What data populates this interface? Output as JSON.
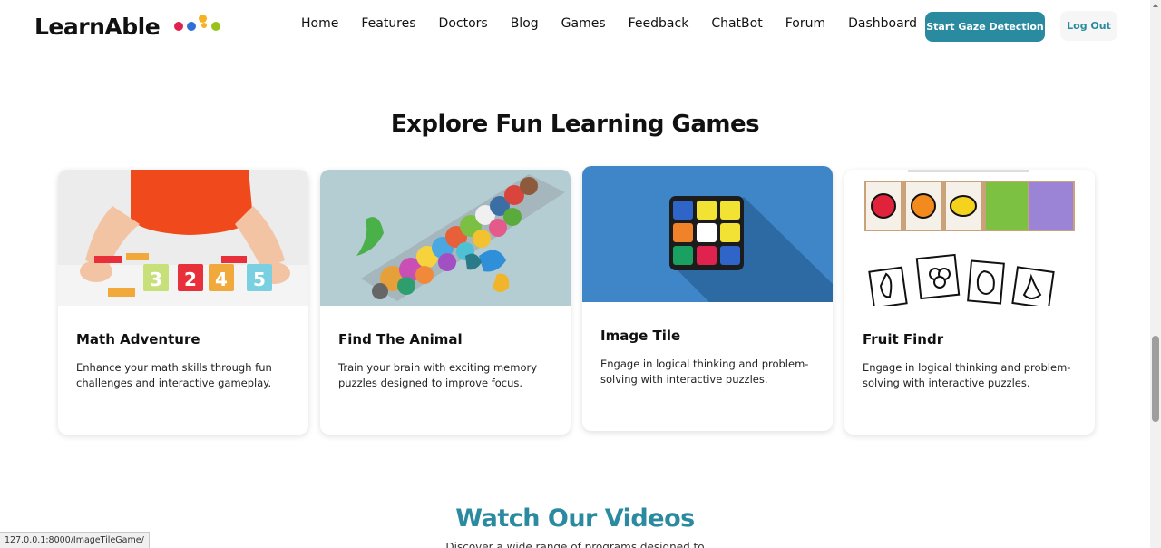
{
  "header": {
    "logo_text": "LearnAble",
    "nav": [
      "Home",
      "Features",
      "Doctors",
      "Blog",
      "Games",
      "Feedback",
      "ChatBot",
      "Forum",
      "Dashboard"
    ],
    "gaze_button": "Start Gaze Detection",
    "logout_button": "Log Out"
  },
  "games_section": {
    "title": "Explore Fun Learning Games",
    "cards": [
      {
        "title": "Math Adventure",
        "description": "Enhance your math skills through fun challenges and interactive gameplay.",
        "blocks": [
          "3",
          "2",
          "4",
          "5"
        ]
      },
      {
        "title": "Find The Animal",
        "description": "Train your brain with exciting memory puzzles designed to improve focus."
      },
      {
        "title": "Image Tile",
        "description": "Engage in logical thinking and problem-solving with interactive puzzles."
      },
      {
        "title": "Fruit Findr",
        "description": "Engage in logical thinking and problem-solving with interactive puzzles."
      }
    ]
  },
  "videos_section": {
    "title": "Watch Our Videos",
    "subtitle": "Discover a wide range of programs designed to"
  },
  "status_url": "127.0.0.1:8000/ImageTileGame/",
  "colors": {
    "accent": "#2a8aa0",
    "logo_dots": [
      "#e0224e",
      "#2f6fd8",
      "#f5b324",
      "#9ac21c"
    ]
  }
}
